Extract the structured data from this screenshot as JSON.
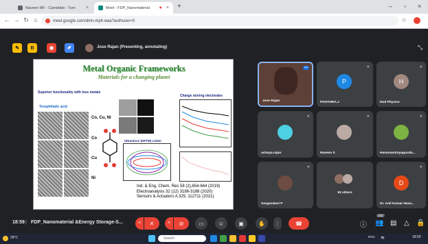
{
  "browser": {
    "tabs": [
      {
        "label": "Naveen MF - Cameldat - Turn",
        "active": false
      },
      {
        "label": "Meet - FDP_Nanomaterial",
        "active": true
      }
    ],
    "new_tab": "+",
    "url": "meet.google.com/dmn-mpit-waa?authuser=0",
    "win_controls": {
      "minimize": "–",
      "restore": "▫",
      "close": "×"
    }
  },
  "meet": {
    "presenter_label": "Jose Rajan (Presenting, annotating)",
    "time": "18:59",
    "meeting_title": "FDP_Nanomaterial &Energy Storage-S...",
    "participant_count": "102",
    "participants": [
      {
        "name": "Jose Rajan",
        "initial": "",
        "color": "#8d6e63",
        "pinned": true
      },
      {
        "name": "PAVITHRA.J",
        "initial": "P",
        "color": "#1e88e5"
      },
      {
        "name": "Hod Physics",
        "initial": "H",
        "color": "#a1887f"
      },
      {
        "name": "ushaya.rajan",
        "initial": "",
        "color": "#4dd0e1"
      },
      {
        "name": "Naveen S",
        "initial": "",
        "color": "#bcaaa4"
      },
      {
        "name": "Hanamantrayagouda...",
        "initial": "",
        "color": "#7cb342"
      },
      {
        "name": "Sorgavalavi P",
        "initial": "",
        "color": "#6d4c41"
      },
      {
        "name": "93 others",
        "initial": "",
        "color": "#8d6e63"
      },
      {
        "name": "Dr. Anil Kumar Nava...",
        "initial": "D",
        "color": "#e64a19"
      }
    ]
  },
  "slide": {
    "title": "Metal Organic Frameworks",
    "subtitle": "Materials for a changing planet",
    "left_heading": "Superior functionality with less metals",
    "acid_label": "Terephthalic acid",
    "metals": [
      "Co, Cu, Ni",
      "Co",
      "Cu",
      "Ni"
    ],
    "chart_title": "Charge storing electrodes",
    "cv_title": "Ultramicro (HFTM) Linker",
    "references": [
      "Ind. & Eng. Chem. Res 58 (2),654-664 (2019)",
      "Electroanalysis 32 (12) 3186-3188 (2020)",
      "Sensors & Actuators A 325, 112711 (2021)"
    ]
  },
  "taskbar": {
    "temp": "28°C",
    "search_placeholder": "Search",
    "lang": "ENG",
    "clock": "18:59"
  },
  "colors": {
    "accent_red": "#ea4335",
    "meet_bg": "#202124",
    "tile_bg": "#3c4043",
    "title_green": "#2e7d32"
  }
}
